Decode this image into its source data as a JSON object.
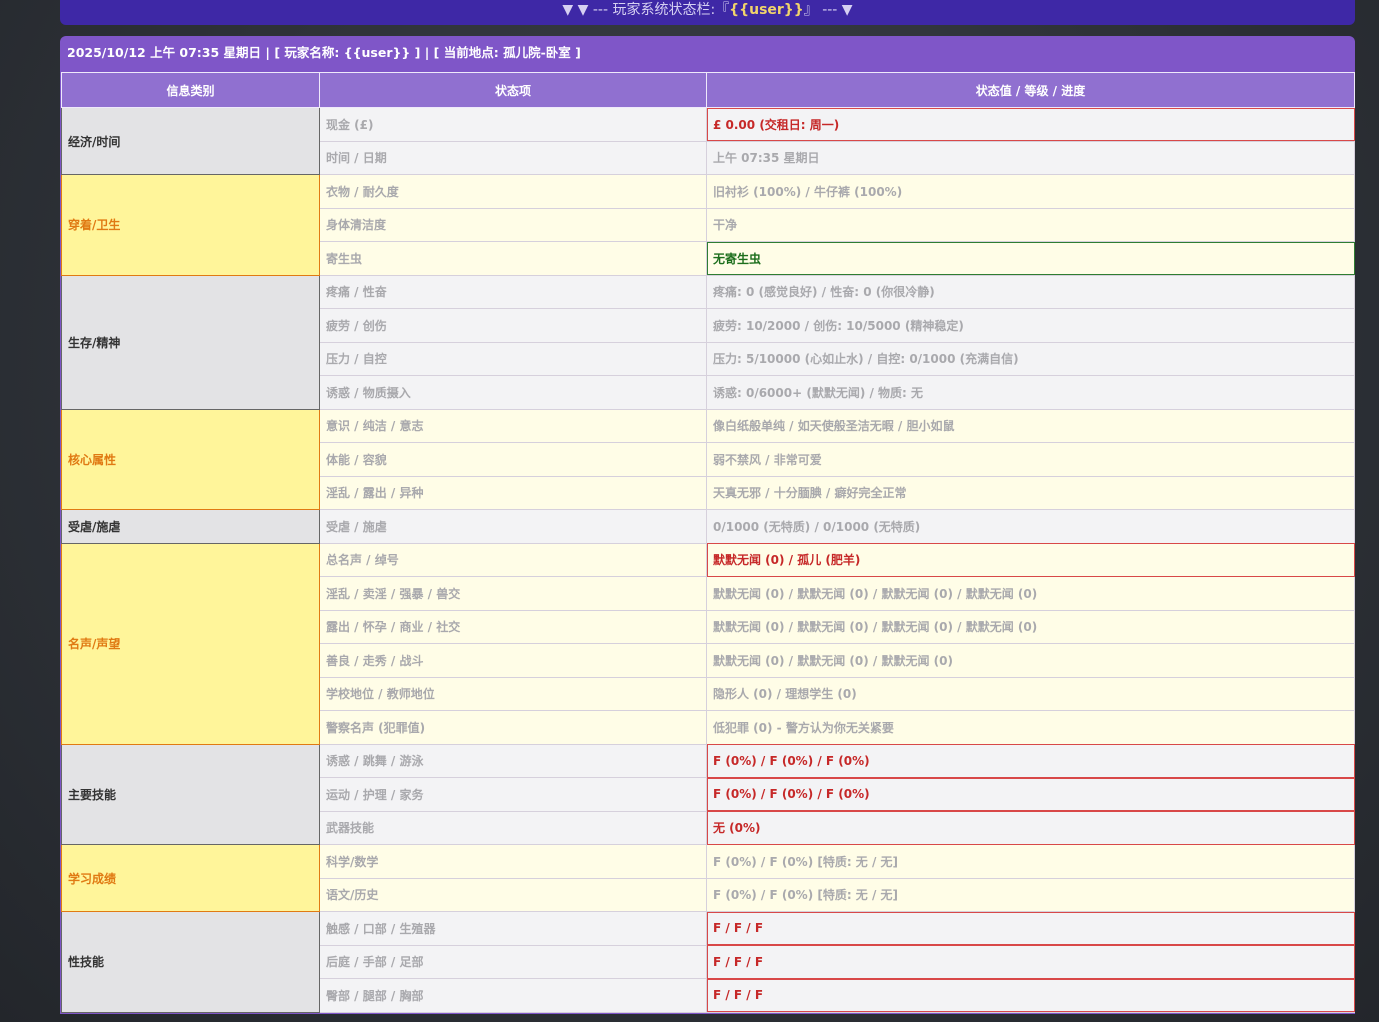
{
  "titlebar": {
    "prefix": "▼ ▼ --- 玩家系统状态栏:『",
    "user": "{{user}}",
    "suffix": "』 --- ▼"
  },
  "infobar": {
    "text": "2025/10/12 上午 07:35 星期日 | [ 玩家名称: {{user}} ] | [ 当前地点: 孤儿院-卧室 ]"
  },
  "table": {
    "headers": [
      "信息类别",
      "状态项",
      "状态值 / 等级 / 进度"
    ],
    "groups": [
      {
        "category": "经济/时间",
        "style": "gray",
        "rows": [
          {
            "item": "现金 (£)",
            "value": "£ 0.00 (交租日: 周一)",
            "highlight": "red"
          },
          {
            "item": "时间 / 日期",
            "value": "上午 07:35 星期日",
            "highlight": ""
          }
        ]
      },
      {
        "category": "穿着/卫生",
        "style": "yellow",
        "rows": [
          {
            "item": "衣物 / 耐久度",
            "value": "旧衬衫 (100%) / 牛仔裤 (100%)",
            "highlight": ""
          },
          {
            "item": "身体清洁度",
            "value": "干净",
            "highlight": ""
          },
          {
            "item": "寄生虫",
            "value": "无寄生虫",
            "highlight": "green"
          }
        ]
      },
      {
        "category": "生存/精神",
        "style": "gray",
        "rows": [
          {
            "item": "疼痛 / 性奋",
            "value": "疼痛: 0 (感觉良好) / 性奋: 0 (你很冷静)",
            "highlight": ""
          },
          {
            "item": "疲劳 / 创伤",
            "value": "疲劳: 10/2000 / 创伤: 10/5000 (精神稳定)",
            "highlight": ""
          },
          {
            "item": "压力 / 自控",
            "value": "压力: 5/10000 (心如止水) / 自控: 0/1000 (充满自信)",
            "highlight": ""
          },
          {
            "item": "诱惑 / 物质摄入",
            "value": "诱惑: 0/6000+ (默默无闻) / 物质: 无",
            "highlight": ""
          }
        ]
      },
      {
        "category": "核心属性",
        "style": "yellow",
        "rows": [
          {
            "item": "意识 / 纯洁 / 意志",
            "value": "像白纸般单纯 / 如天使般圣洁无暇 / 胆小如鼠",
            "highlight": ""
          },
          {
            "item": "体能 / 容貌",
            "value": "弱不禁风 / 非常可爱",
            "highlight": ""
          },
          {
            "item": "淫乱 / 露出 / 异种",
            "value": "天真无邪 / 十分腼腆 / 癖好完全正常",
            "highlight": ""
          }
        ]
      },
      {
        "category": "受虐/施虐",
        "style": "gray",
        "rows": [
          {
            "item": "受虐 / 施虐",
            "value": "0/1000 (无特质) / 0/1000 (无特质)",
            "highlight": ""
          }
        ]
      },
      {
        "category": "名声/声望",
        "style": "yellow",
        "rows": [
          {
            "item": "总名声 / 绰号",
            "value": "默默无闻 (0) / 孤儿 (肥羊)",
            "highlight": "red"
          },
          {
            "item": "淫乱 / 卖淫 / 强暴 / 兽交",
            "value": "默默无闻 (0) / 默默无闻 (0) / 默默无闻 (0) / 默默无闻 (0)",
            "highlight": ""
          },
          {
            "item": "露出 / 怀孕 / 商业 / 社交",
            "value": "默默无闻 (0) / 默默无闻 (0) / 默默无闻 (0) / 默默无闻 (0)",
            "highlight": ""
          },
          {
            "item": "善良 / 走秀 / 战斗",
            "value": "默默无闻 (0) / 默默无闻 (0) / 默默无闻 (0)",
            "highlight": ""
          },
          {
            "item": "学校地位 / 教师地位",
            "value": "隐形人 (0) / 理想学生 (0)",
            "highlight": ""
          },
          {
            "item": "警察名声 (犯罪值)",
            "value": "低犯罪 (0) - 警方认为你无关紧要",
            "highlight": ""
          }
        ]
      },
      {
        "category": "主要技能",
        "style": "gray",
        "rows": [
          {
            "item": "诱惑 / 跳舞 / 游泳",
            "value": "F (0%) / F (0%) / F (0%)",
            "highlight": "red"
          },
          {
            "item": "运动 / 护理 / 家务",
            "value": "F (0%) / F (0%) / F (0%)",
            "highlight": "red"
          },
          {
            "item": "武器技能",
            "value": "无 (0%)",
            "highlight": "red"
          }
        ]
      },
      {
        "category": "学习成绩",
        "style": "yellow",
        "rows": [
          {
            "item": "科学/数学",
            "value": "F (0%) / F (0%) [特质: 无 / 无]",
            "highlight": ""
          },
          {
            "item": "语文/历史",
            "value": "F (0%) / F (0%) [特质: 无 / 无]",
            "highlight": ""
          }
        ]
      },
      {
        "category": "性技能",
        "style": "gray",
        "rows": [
          {
            "item": "触感 / 口部 / 生殖器",
            "value": "F / F / F",
            "highlight": "red"
          },
          {
            "item": "后庭 / 手部 / 足部",
            "value": "F / F / F",
            "highlight": "red"
          },
          {
            "item": "臀部 / 腿部 / 胸部",
            "value": "F / F / F",
            "highlight": "red"
          }
        ]
      }
    ]
  }
}
